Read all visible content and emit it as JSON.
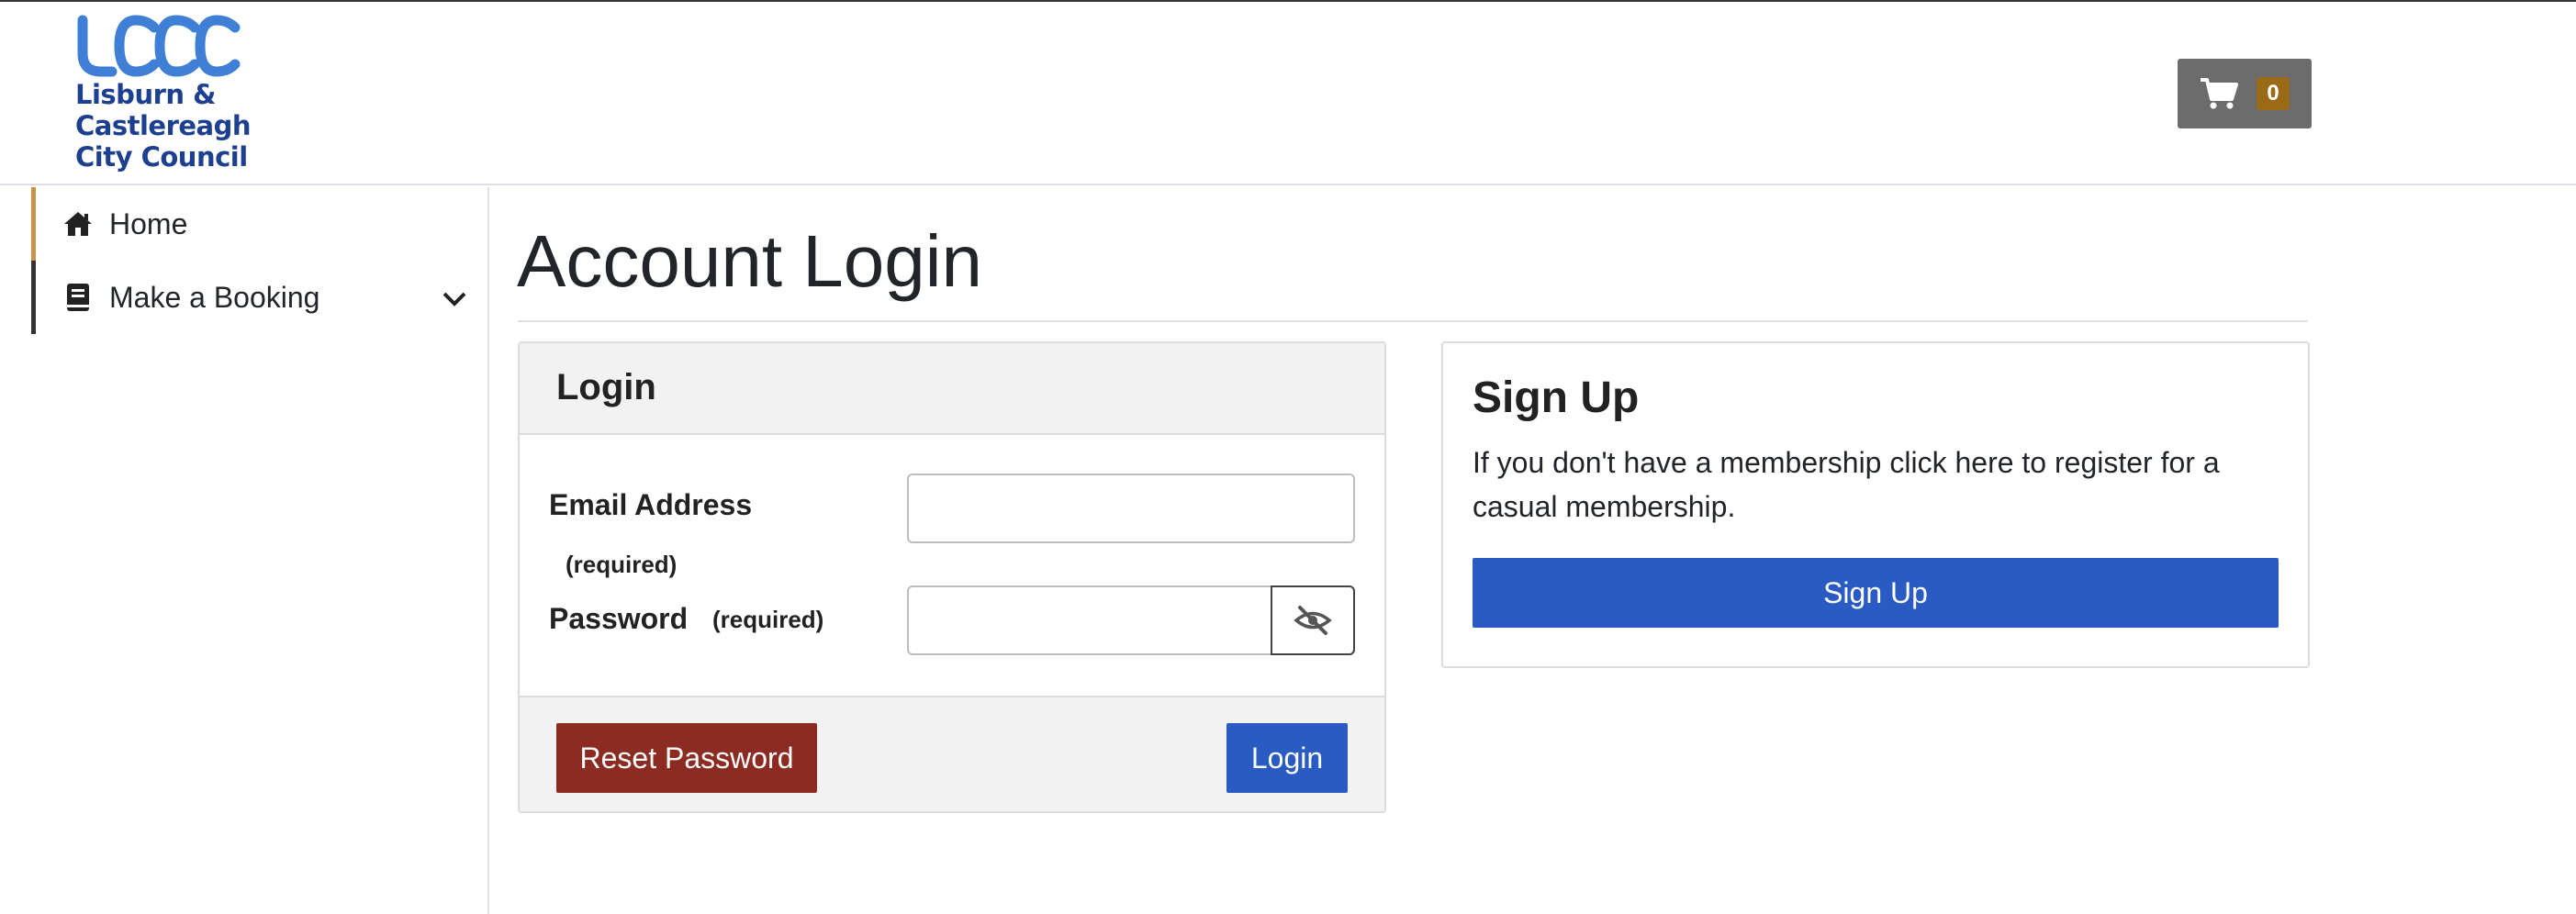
{
  "header": {
    "logo": {
      "mark_text": "LCCC",
      "lines": [
        "Lisburn &",
        "Castlereagh",
        "City Council"
      ],
      "brand_color": "#1c3f8f",
      "accent_color": "#3f7fd6"
    },
    "cart": {
      "icon": "shopping-cart-icon",
      "count": "0"
    }
  },
  "sidebar": {
    "items": [
      {
        "label": "Home",
        "icon": "home-icon"
      },
      {
        "label": "Make a Booking",
        "icon": "book-icon",
        "expand_icon": "chevron-down-icon"
      }
    ]
  },
  "main": {
    "title": "Account Login",
    "login_card": {
      "header": "Login",
      "email_label": "Email Address",
      "email_required": "(required)",
      "email_value": "",
      "password_label": "Password",
      "password_required": "(required)",
      "password_value": "",
      "toggle_icon": "eye-slash-icon",
      "reset_button": "Reset Password",
      "login_button": "Login"
    },
    "signup_card": {
      "title": "Sign Up",
      "description": "If you don't have a membership click here to register for a casual membership.",
      "button": "Sign Up"
    }
  },
  "colors": {
    "primary": "#2a5bc3",
    "danger": "#8c2b22",
    "cart_bg": "#6c6c6c",
    "cart_badge": "#9a6a16",
    "home_accent": "#c8944a"
  }
}
